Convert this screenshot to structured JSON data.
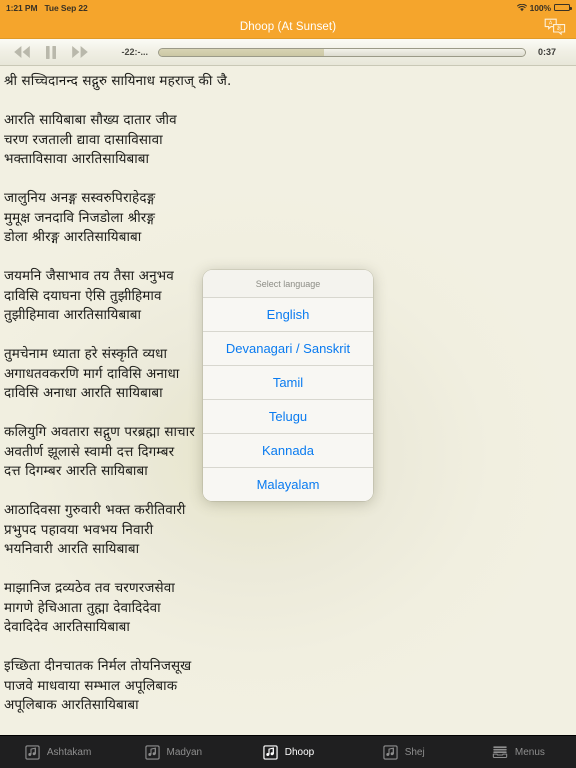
{
  "status_bar": {
    "time": "1:21 PM",
    "date": "Tue Sep 22",
    "battery_percent": "100%",
    "wifi_icon": "wifi-icon",
    "battery_icon": "battery-icon"
  },
  "nav_bar": {
    "title": "Dhoop (At Sunset)",
    "translate_icon": "translate-icon",
    "background_color": "#f5a52c",
    "title_color": "#ffffff"
  },
  "player": {
    "rewind_icon": "rewind-icon",
    "pause_icon": "pause-icon",
    "forward_icon": "fast-forward-icon",
    "time_remaining": "-22:-...",
    "time_elapsed": "0:37",
    "progress_percent": 45
  },
  "content": {
    "lyrics": "श्री सच्चिदानन्द सद्गुरु सायिनाध महराज् की जै.\n\nआरति सायिबाबा सौख्य दातार जीव\nचरण रजताली द्यावा दासाविसावा\nभक्ताविसावा आरतिसायिबाबा\n\nजालुनिय अनङ्ग सस्वरुपिराहेदङ्ग\nमुमूक्ष जनदावि निजडोला श्रीरङ्ग\nडोला श्रीरङ्ग आरतिसायिबाबा\n\nजयमनि जैसाभाव तय तैसा अनुभव\nदाविसि दयाघना ऐसि तुझीहिमाव\nतुझीहिमावा आरतिसायिबाबा\n\nतुमचेनाम ध्याता हरे संस्कृति व्यधा\nअगाधतवकरणि मार्ग दाविसि अनाधा\nदाविसि अनाधा आरति सायिबाबा\n\nकलियुगि अवतारा सद्गुण परब्रह्मा साचार\nअवतीर्ण झूलासे स्वामी दत्त दिगम्बर\nदत्त दिगम्बर आरति सायिबाबा\n\nआठादिवसा गुरुवारी भक्त करीतिवारी\nप्रभुपद पहावया भवभय निवारी\nभयनिवारी आरति सायिबाबा\n\nमाझानिज द्रव्यठेव तव चरणरजसेवा\nमागणे हेचिआता तुह्मा देवादिदेवा\nदेवादिदेव आरतिसायिबाबा\n\nइच्छिता दीनचातक निर्मल तोयनिजसूख\nपाजवे माधवाया सम्भाल अपूलिबाक\nअपूलिबाक आरतिसायिबाबा"
  },
  "action_sheet": {
    "title": "Select language",
    "items": [
      {
        "label": "English"
      },
      {
        "label": "Devanagari / Sanskrit"
      },
      {
        "label": "Tamil"
      },
      {
        "label": "Telugu"
      },
      {
        "label": "Kannada"
      },
      {
        "label": "Malayalam"
      }
    ],
    "item_color": "#0a7bf0"
  },
  "tab_bar": {
    "tabs": [
      {
        "label": "Ashtakam",
        "icon": "music-note-icon",
        "active": false
      },
      {
        "label": "Madyan",
        "icon": "music-note-icon",
        "active": false
      },
      {
        "label": "Dhoop",
        "icon": "music-note-icon",
        "active": true
      },
      {
        "label": "Shej",
        "icon": "music-note-icon",
        "active": false
      },
      {
        "label": "Menus",
        "icon": "tray-stack-icon",
        "active": false
      }
    ]
  }
}
